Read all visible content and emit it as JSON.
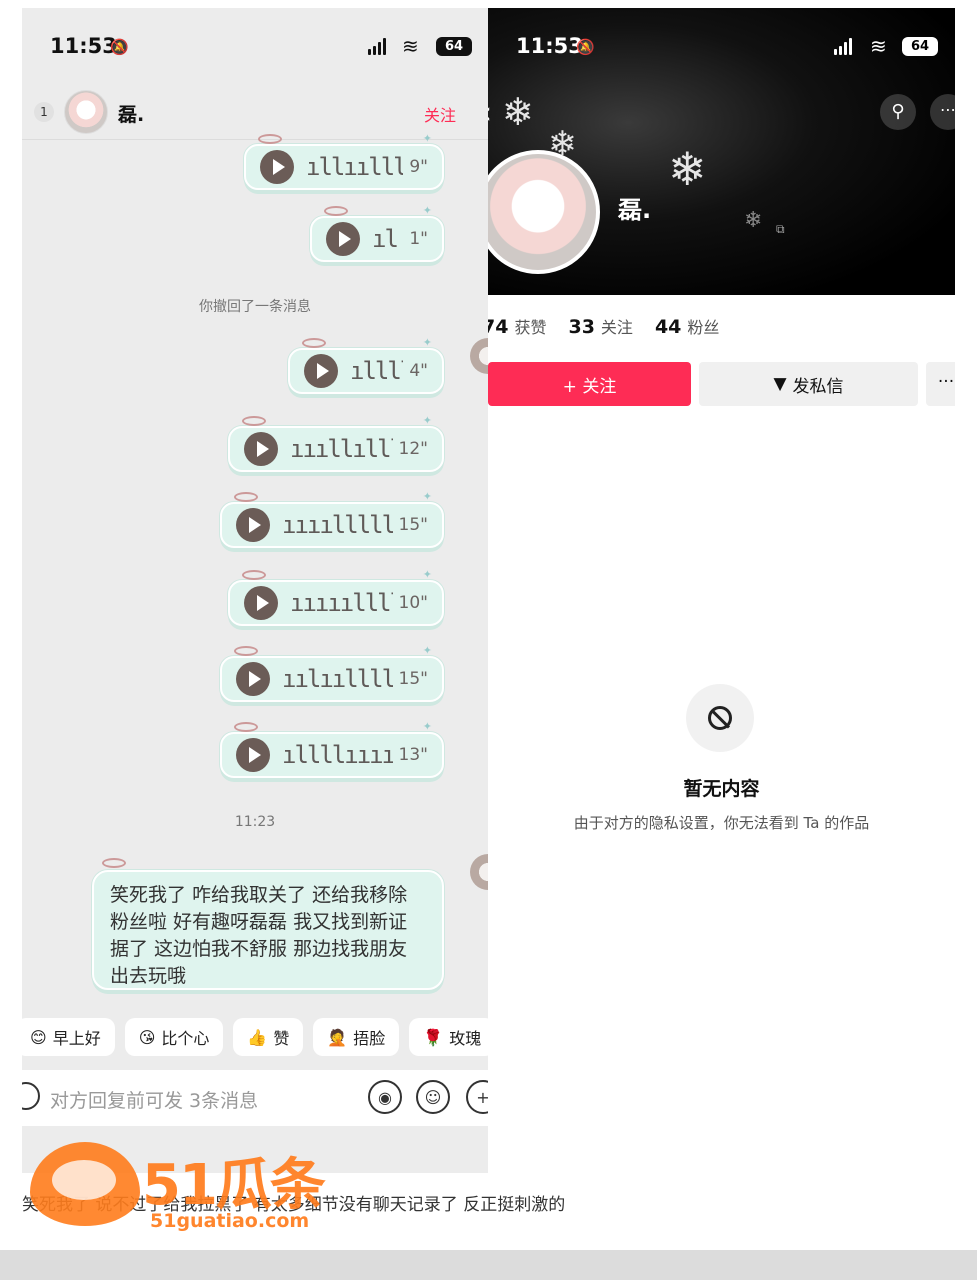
{
  "chat": {
    "status": {
      "time": "11:53",
      "battery": "64"
    },
    "header": {
      "badge": "1",
      "name": "磊.",
      "follow": "关注"
    },
    "voice_top": [
      {
        "duration": "9\"",
        "wave": "ıllıılllllll"
      },
      {
        "duration": "1\"",
        "wave": "ıl"
      }
    ],
    "recall_notice": "你撤回了一条消息",
    "voice_mine": [
      {
        "duration": "4\"",
        "wave": "ıllll"
      },
      {
        "duration": "12\"",
        "wave": "ıııllıllllll"
      },
      {
        "duration": "15\"",
        "wave": "ıııılllllllll"
      },
      {
        "duration": "10\"",
        "wave": "ııııılllllll"
      },
      {
        "duration": "15\"",
        "wave": "ıılıılllllıl"
      },
      {
        "duration": "13\"",
        "wave": "ıllllııııllı"
      }
    ],
    "time_divider": "11:23",
    "text_message": "笑死我了 咋给我取关了 还给我移除粉丝啦 好有趣呀磊磊 我又找到新证据了 这边怕我不舒服 那边找我朋友出去玩哦",
    "quick_replies": [
      {
        "emoji": "😊",
        "label": "早上好"
      },
      {
        "emoji": "😘",
        "label": "比个心"
      },
      {
        "emoji": "👍",
        "label": "赞"
      },
      {
        "emoji": "🤦",
        "label": "捂脸"
      },
      {
        "emoji": "🌹",
        "label": "玫瑰"
      }
    ],
    "input_placeholder": "对方回复前可发 3条消息"
  },
  "profile": {
    "status": {
      "time": "11:53",
      "battery": "64"
    },
    "name": "磊.",
    "stats": [
      {
        "value": "74",
        "label": "获赞"
      },
      {
        "value": "33",
        "label": "关注"
      },
      {
        "value": "44",
        "label": "粉丝"
      }
    ],
    "follow_button": "+ 关注",
    "dm_button": "发私信",
    "more_button": "···",
    "empty_title": "暂无内容",
    "empty_subtitle": "由于对方的隐私设置，你无法看到 Ta 的作品"
  },
  "caption": "笑死我了 说不过了给我拉黑了 有太多细节没有聊天记录了 反正挺刺激的",
  "watermark": {
    "brand": "51瓜条",
    "url": "51guatiao.com"
  },
  "colors": {
    "accent": "#fe2c55",
    "bubble": "#dff4ee",
    "watermark": "#ff7c1c"
  }
}
